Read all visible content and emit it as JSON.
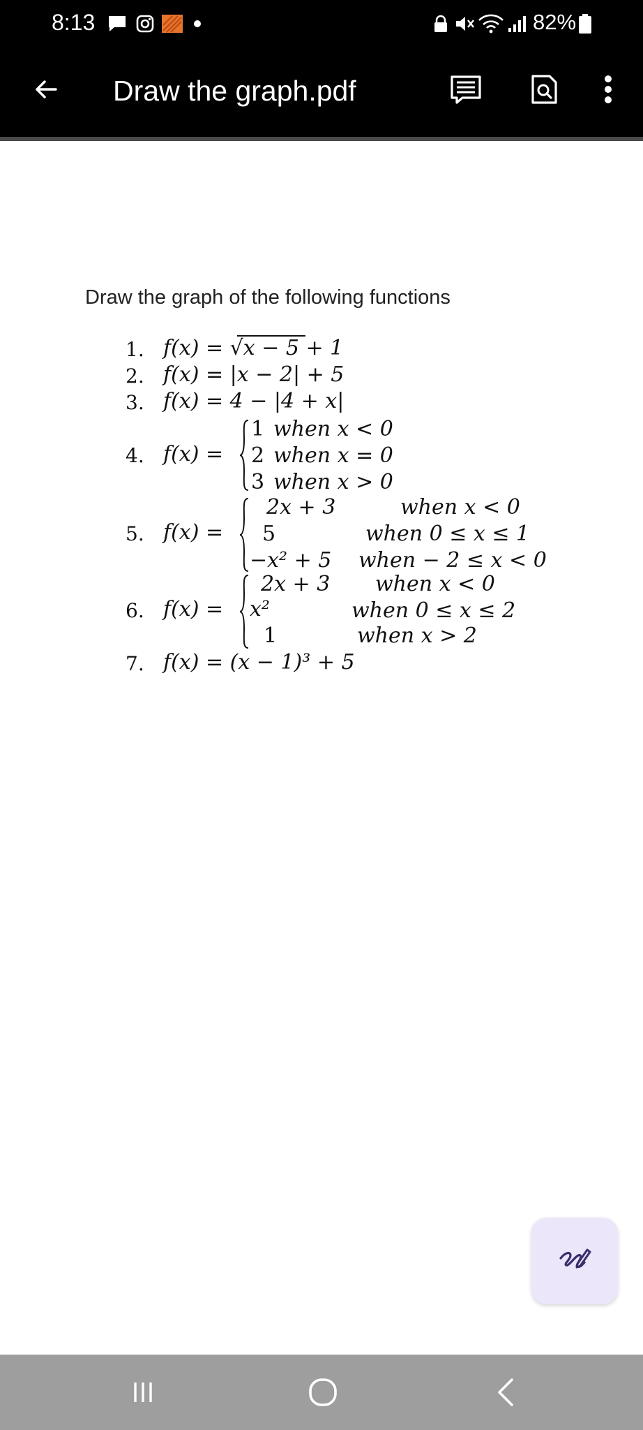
{
  "status_bar": {
    "time": "8:13",
    "battery_percent": "82%"
  },
  "toolbar": {
    "title": "Draw the graph.pdf",
    "back_icon": "arrow-left-icon",
    "reading_mode_icon": "reading-mode-icon",
    "search_icon": "find-in-document-icon",
    "more_icon": "more-vert-icon"
  },
  "document": {
    "heading": "Draw the graph of the following functions",
    "items": [
      {
        "num": "1.",
        "expr": "f(x) = √x − 5 + 1"
      },
      {
        "num": "2.",
        "expr": "f(x) = |x − 2| + 5"
      },
      {
        "num": "3.",
        "expr": "f(x) = 4 − |4 + x|"
      },
      {
        "num": "4.",
        "lhs": "f(x) =",
        "cases": [
          {
            "val": "1",
            "cond": "when x < 0"
          },
          {
            "val": "2",
            "cond": "when x = 0"
          },
          {
            "val": "3",
            "cond": "when x > 0"
          }
        ]
      },
      {
        "num": "5.",
        "lhs": "f(x) =",
        "cases": [
          {
            "val": "2x + 3",
            "cond": "when x < 0"
          },
          {
            "val": "5",
            "cond": "when 0 ≤ x ≤ 1"
          },
          {
            "val": "−x² + 5",
            "cond": "when − 2 ≤ x < 0"
          }
        ]
      },
      {
        "num": "6.",
        "lhs": "f(x) =",
        "cases": [
          {
            "val": "2x + 3",
            "cond": "when x < 0"
          },
          {
            "val": "x²",
            "cond": "when 0 ≤ x ≤ 2"
          },
          {
            "val": "1",
            "cond": "when x > 2"
          }
        ]
      },
      {
        "num": "7.",
        "expr": "f(x) = (x − 1)³ + 5"
      }
    ]
  },
  "fab": {
    "icon": "annotate-pen-icon"
  },
  "nav_bar": {
    "recents_icon": "recent-apps-icon",
    "home_icon": "home-icon",
    "back_icon": "back-chevron-icon"
  },
  "colors": {
    "toolbar_bg": "#000000",
    "nav_bg": "#9e9e9e",
    "fab_bg": "#ece6fa",
    "fab_icon": "#3a2e6b",
    "notification_orange": "#e8742c"
  }
}
